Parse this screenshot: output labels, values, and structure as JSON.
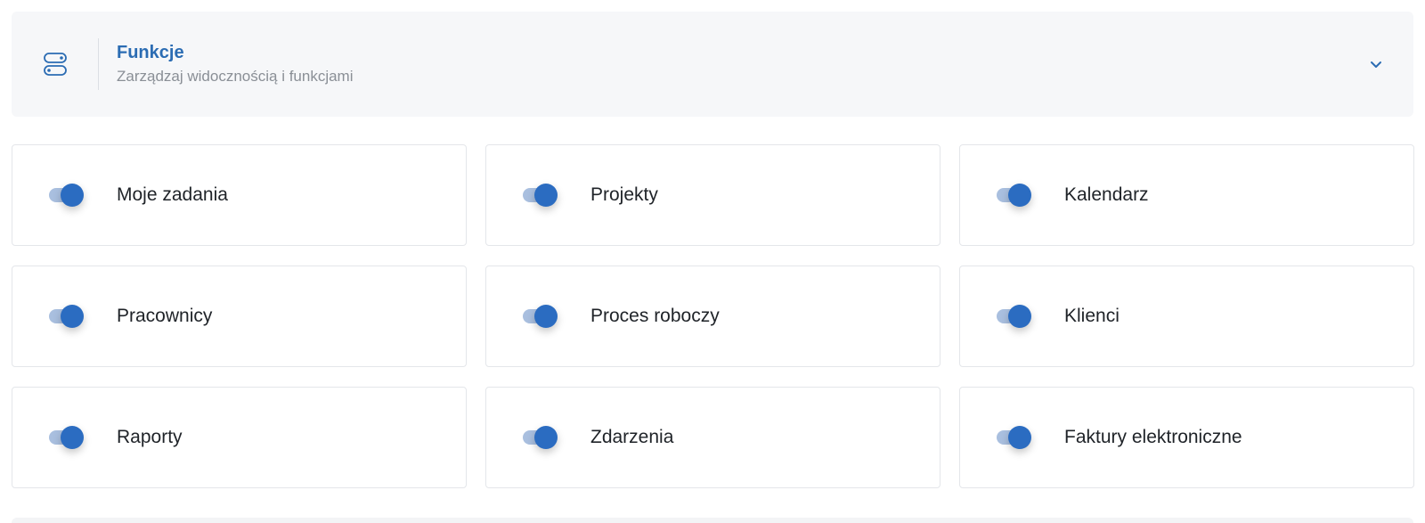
{
  "header": {
    "icon": "toggles-icon",
    "title": "Funkcje",
    "subtitle": "Zarządzaj widocznością i funkcjami",
    "chevron_icon": "chevron-down-icon",
    "accent_color": "#2b6cb3"
  },
  "features": [
    {
      "label": "Moje zadania",
      "enabled": true
    },
    {
      "label": "Projekty",
      "enabled": true
    },
    {
      "label": "Kalendarz",
      "enabled": true
    },
    {
      "label": "Pracownicy",
      "enabled": true
    },
    {
      "label": "Proces roboczy",
      "enabled": true
    },
    {
      "label": "Klienci",
      "enabled": true
    },
    {
      "label": "Raporty",
      "enabled": true
    },
    {
      "label": "Zdarzenia",
      "enabled": true
    },
    {
      "label": "Faktury elektroniczne",
      "enabled": true
    }
  ],
  "colors": {
    "toggle_on_knob": "#2b6cc1",
    "toggle_on_track": "#a9bfdf",
    "header_background": "#f6f7f9"
  }
}
